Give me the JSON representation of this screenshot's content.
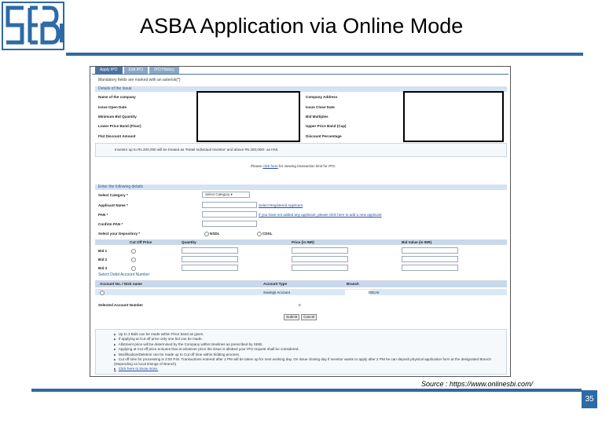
{
  "slide": {
    "title": "ASBA Application via Online Mode",
    "source": "Source : https://www.onlinesbi.com/",
    "page_number": "35",
    "accent_color": "#2e6aa6",
    "logo_text": "SEBI"
  },
  "screenshot": {
    "tabs": [
      "Apply IPO",
      "Edit IPO",
      "IPO History"
    ],
    "mandatory_note": "Mandatory fields are marked with an asterisk(*)",
    "issue_section": "Details of the Issue",
    "issue_left_labels": [
      "Name of the company",
      "Issue Open Date",
      "Minimum Bid Quantity",
      "Lower Price Band (Floor)",
      "Flat Discount Amount"
    ],
    "issue_right_labels": [
      "Company Address",
      "Issue Close Date",
      "Bid Multiples",
      "Upper Price Band (Cap)",
      "Discount Percentage"
    ],
    "investor_note": "Investor up to Rs.200,000 will be treated as 'Retail Individual Investor' and above Rs.200,000/- as HNI.",
    "transaction_note_prefix": "Please",
    "transaction_note_link": "click here",
    "transaction_note_suffix": "for viewing transaction limit for IPO.",
    "details_section": "Enter the following details",
    "form_labels": [
      "Select Category *",
      "Applicant Name *",
      "PAN *",
      "Confirm PAN *",
      "Select your Depository *"
    ],
    "category_placeholder": "Select Category",
    "registered_link": "Select Registered Applicant",
    "new_applicant_link": "If you have not added any applicant, please click here to add a new applicant",
    "depositories": [
      "NSDL",
      "CDSL"
    ],
    "bid_headers": [
      "Cut Off Price",
      "Quantity",
      "Price (in INR)",
      "Bid Value (in INR)"
    ],
    "bids": [
      "Bid 1",
      "Bid 2",
      "Bid 3"
    ],
    "debit_section": "Select Debit Account Number",
    "account_headers": [
      "Account No. / Nick name",
      "Account Type",
      "Branch"
    ],
    "account_type": "Savings Account",
    "account_branch": "DELHI",
    "selected_account_label": "Selected Account Number",
    "selected_account_value": "0",
    "submit_label": "Submit",
    "cancel_label": "Cancel",
    "bullets": [
      "Up to 3 Bids can be made within Price band as given.",
      "If applying at Cut off price only one bid can be made.",
      "Allotment price will be determined by the Company within timelines as prescribed by SEBI.",
      "Applying at Cut off price ensures that at whatever price the issue is allotted your IPO request shall be considered.",
      "Modification/Deletion can be made up to Cut off time within bidding process.",
      "Cut off time for processing is 2:00 P.M. Transactions entered after 2 PM will be taken up for next working day. On issue closing day if investor wants to apply after 2 PM he can deposit physical application form at the designated Branch (Depending on local timings of Branch)",
      "Click here to know more."
    ]
  }
}
